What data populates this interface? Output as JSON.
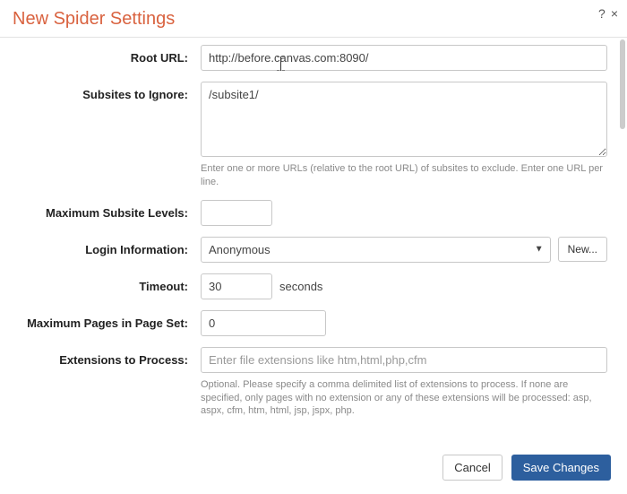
{
  "dialog": {
    "title": "New Spider Settings",
    "help_tooltip": "?",
    "close_tooltip": "×"
  },
  "form": {
    "root_url": {
      "label": "Root URL:",
      "value": "http://before.canvas.com:8090/"
    },
    "subsites": {
      "label": "Subsites to Ignore:",
      "value": "/subsite1/",
      "helper": "Enter one or more URLs (relative to the root URL) of subsites to exclude. Enter one URL per line."
    },
    "max_levels": {
      "label": "Maximum Subsite Levels:",
      "value": ""
    },
    "login": {
      "label": "Login Information:",
      "selected": "Anonymous",
      "new_button": "New..."
    },
    "timeout": {
      "label": "Timeout:",
      "value": "30",
      "unit": "seconds"
    },
    "max_pages": {
      "label": "Maximum Pages in Page Set:",
      "value": "0"
    },
    "extensions": {
      "label": "Extensions to Process:",
      "placeholder": "Enter file extensions like htm,html,php,cfm",
      "value": "",
      "helper": "Optional. Please specify a comma delimited list of extensions to process. If none are specified, only pages with no extension or any of these extensions will be processed: asp, aspx, cfm, htm, html, jsp, jspx, php."
    }
  },
  "footer": {
    "cancel": "Cancel",
    "save": "Save Changes"
  }
}
